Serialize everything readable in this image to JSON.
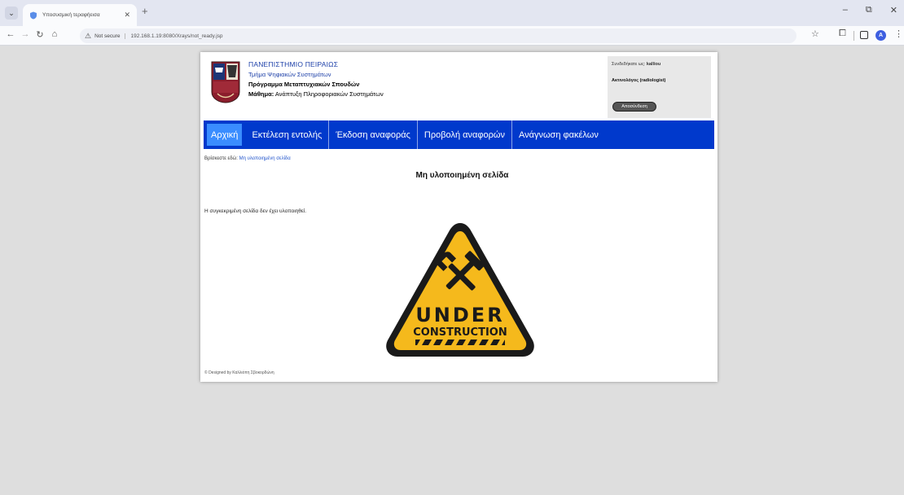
{
  "browser": {
    "tab_title": "Υποσυσμική τεραφήεισα",
    "new_tab": "+",
    "not_secure": "Not secure",
    "url": "192.168.1.19:8080/Xrays/not_ready.jsp"
  },
  "header": {
    "university": "ΠΑΝΕΠΙΣΤΗΜΙΟ ΠΕΙΡΑΙΩΣ",
    "department": "Τμήμα Ψηφιακών Συστημάτων",
    "program": "Πρόγραμμα Μεταπτυχιακών Σπουδών",
    "course_label": "Μάθημα:",
    "course_name": " Ανάπτυξη Πληροφοριακών Συστημάτων"
  },
  "user": {
    "logged_label": "Συνδεδήκατε ως: ",
    "username": "kalliou",
    "role": "Ακτινολόγος (radiologist)",
    "logout": "Αποσύνδεση"
  },
  "nav": [
    {
      "label": "Αρχική",
      "active": true
    },
    {
      "label": "Εκτέλεση εντολής",
      "active": false
    },
    {
      "label": "Έκδοση αναφοράς",
      "active": false
    },
    {
      "label": "Προβολή αναφορών",
      "active": false
    },
    {
      "label": "Ανάγνωση φακέλων",
      "active": false
    }
  ],
  "breadcrumb": {
    "prefix": "Βρίσκεστε εδώ: ",
    "current": "Μη υλοποιημένη σελίδα"
  },
  "content": {
    "title": "Μη υλοποιημένη σελίδα",
    "message": "Η συγκεκριμένη σελίδα δεν έχει υλοποιηθεί.",
    "sign_line1": "UNDER",
    "sign_line2": "CONSTRUCTION"
  },
  "footer": "© Designed by Καλλιόπη Σβοκορδώνη",
  "colors": {
    "nav_bg": "#0039cc",
    "nav_active": "#3a8dff",
    "link": "#1c3fa8",
    "sign_yellow": "#f5b91c"
  }
}
